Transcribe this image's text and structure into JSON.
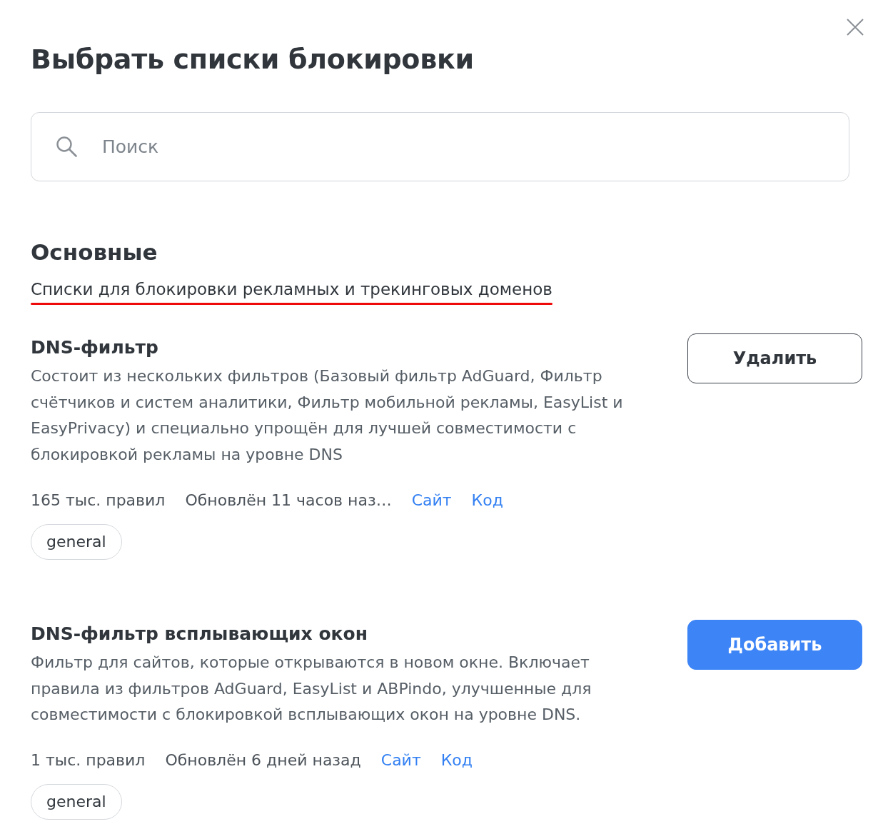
{
  "dialog": {
    "title": "Выбрать списки блокировки"
  },
  "search": {
    "placeholder": "Поиск"
  },
  "section": {
    "title": "Основные",
    "subtitle": "Списки для блокировки рекламных и трекинговых доменов",
    "subtitle_underlined": true
  },
  "filters": [
    {
      "name": "DNS-фильтр",
      "description": "Состоит из нескольких фильтров (Базовый фильтр AdGuard, Фильтр счётчиков и систем аналитики, Фильтр мобильной рекламы, EasyList и EasyPrivacy) и специально упрощён для лучшей совместимости с блокировкой рекламы на уровне DNS",
      "rules": "165 тыс. правил",
      "updated": "Обновлён 11 часов наз…",
      "links": [
        "Сайт",
        "Код"
      ],
      "tags": [
        "general"
      ],
      "action": {
        "label": "Удалить",
        "kind": "remove"
      }
    },
    {
      "name": "DNS-фильтр всплывающих окон",
      "description": "Фильтр для сайтов, которые открываются в новом окне. Включает правила из фильтров AdGuard, EasyList и ABPindo, улучшенные для совместимости с блокировкой всплывающих окон на уровне DNS.",
      "rules": "1 тыс. правил",
      "updated": "Обновлён 6 дней назад",
      "links": [
        "Сайт",
        "Код"
      ],
      "tags": [
        "general"
      ],
      "action": {
        "label": "Добавить",
        "kind": "add"
      }
    }
  ]
}
